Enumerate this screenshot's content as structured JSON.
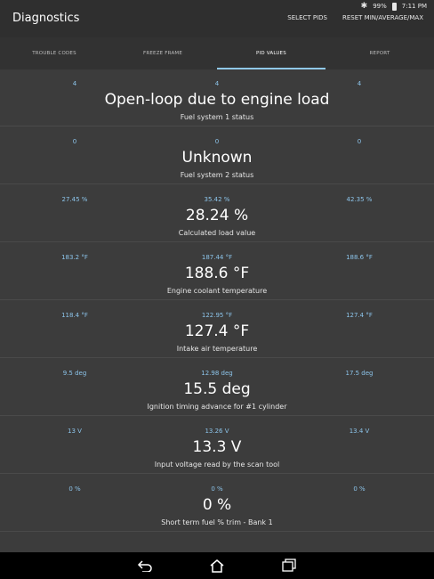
{
  "status": {
    "battery": "99%",
    "time": "7:11 PM"
  },
  "app": {
    "title": "Diagnostics",
    "select_pids": "SELECT PIDS",
    "reset": "RESET MIN/AVERAGE/MAX"
  },
  "tabs": [
    {
      "label": "TROUBLE CODES"
    },
    {
      "label": "FREEZE FRAME"
    },
    {
      "label": "PID VALUES"
    },
    {
      "label": "REPORT"
    }
  ],
  "pids": [
    {
      "min": "4",
      "avg": "4",
      "max": "4",
      "value": "Open-loop due to engine load",
      "name": "Fuel system 1 status"
    },
    {
      "min": "0",
      "avg": "0",
      "max": "0",
      "value": "Unknown",
      "name": "Fuel system 2 status"
    },
    {
      "min": "27.45 %",
      "avg": "35.42 %",
      "max": "42.35 %",
      "value": "28.24 %",
      "name": "Calculated load value"
    },
    {
      "min": "183.2 °F",
      "avg": "187.44 °F",
      "max": "188.6 °F",
      "value": "188.6 °F",
      "name": "Engine coolant temperature"
    },
    {
      "min": "118.4 °F",
      "avg": "122.95 °F",
      "max": "127.4 °F",
      "value": "127.4 °F",
      "name": "Intake air temperature"
    },
    {
      "min": "9.5 deg",
      "avg": "12.98 deg",
      "max": "17.5 deg",
      "value": "15.5 deg",
      "name": "Ignition timing advance for #1 cylinder"
    },
    {
      "min": "13 V",
      "avg": "13.26 V",
      "max": "13.4 V",
      "value": "13.3 V",
      "name": "Input voltage read by the scan tool"
    },
    {
      "min": "0 %",
      "avg": "0 %",
      "max": "0 %",
      "value": "0 %",
      "name": "Short term fuel % trim - Bank 1"
    }
  ]
}
